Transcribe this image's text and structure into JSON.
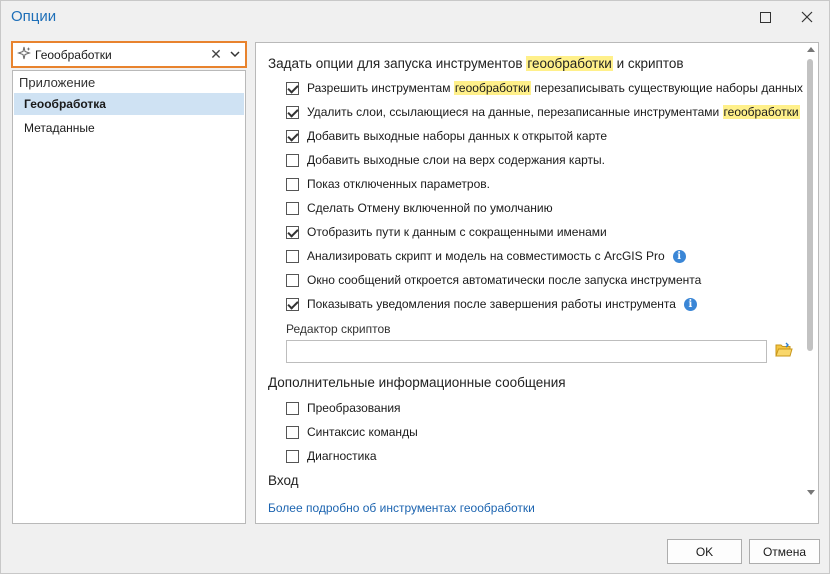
{
  "window": {
    "title": "Опции"
  },
  "search": {
    "value": "Геообработки",
    "clear_glyph": "✕"
  },
  "nav": {
    "header": "Приложение",
    "items": [
      {
        "label": "Геообработка",
        "selected": true
      },
      {
        "label": "Метаданные",
        "selected": false
      }
    ]
  },
  "panel": {
    "section1": {
      "title_prefix": "Задать опции для запуска инструментов ",
      "title_highlight": "геообработки",
      "title_suffix": " и скриптов"
    },
    "options": [
      {
        "checked": true,
        "before": "Разрешить инструментам ",
        "highlight": "геообработки",
        "after": " перезаписывать существующие наборы данных",
        "info": false
      },
      {
        "checked": true,
        "before": "Удалить слои, ссылающиеся на данные, перезаписанные инструментами ",
        "highlight": "геообработки",
        "after": "",
        "info": false
      },
      {
        "checked": true,
        "before": "Добавить выходные наборы данных к открытой карте",
        "highlight": "",
        "after": "",
        "info": false
      },
      {
        "checked": false,
        "before": "Добавить выходные слои на верх содержания карты.",
        "highlight": "",
        "after": "",
        "info": false
      },
      {
        "checked": false,
        "before": "Показ отключенных параметров.",
        "highlight": "",
        "after": "",
        "info": false
      },
      {
        "checked": false,
        "before": "Сделать Отмену включенной по умолчанию",
        "highlight": "",
        "after": "",
        "info": false
      },
      {
        "checked": true,
        "before": "Отобразить пути к данным с сокращенными именами",
        "highlight": "",
        "after": "",
        "info": false
      },
      {
        "checked": false,
        "before": "Анализировать скрипт и модель на совместимость с ArcGIS Pro",
        "highlight": "",
        "after": "",
        "info": true
      },
      {
        "checked": false,
        "before": "Окно сообщений откроется автоматически после запуска инструмента",
        "highlight": "",
        "after": "",
        "info": false
      },
      {
        "checked": true,
        "before": "Показывать уведомления после завершения работы инструмента",
        "highlight": "",
        "after": "",
        "info": true
      }
    ],
    "script_editor_label": "Редактор скриптов",
    "script_editor_value": "",
    "section2_title": "Дополнительные информационные сообщения",
    "messages": [
      {
        "checked": false,
        "label": "Преобразования"
      },
      {
        "checked": false,
        "label": "Синтаксис команды"
      },
      {
        "checked": false,
        "label": "Диагностика"
      }
    ],
    "section3_title": "Вход",
    "link": "Более подробно об инструментах геообработки"
  },
  "buttons": {
    "ok": "OK",
    "cancel": "Отмена"
  },
  "colors": {
    "accent": "#1e6fb8",
    "highlight": "#fff08a",
    "search_border": "#e8832e",
    "selection": "#cfe2f3"
  }
}
